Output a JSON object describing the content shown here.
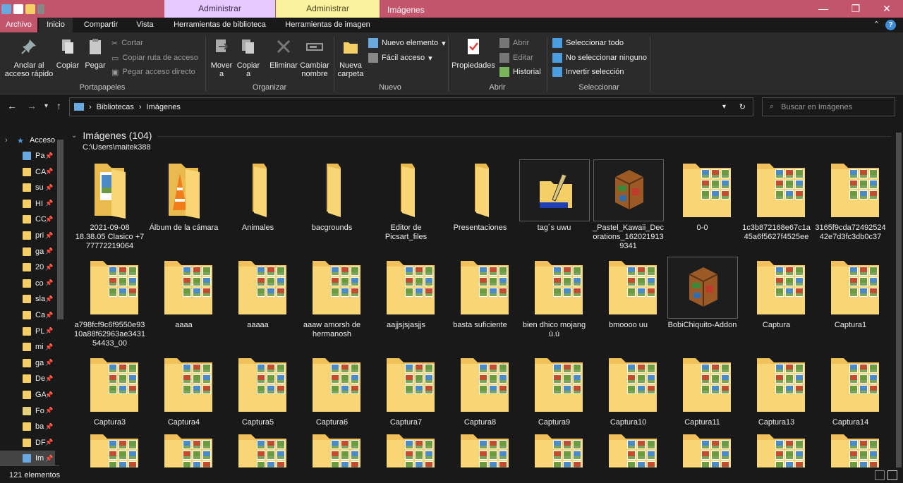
{
  "window": {
    "context_tab_1": "Administrar",
    "context_tab_2": "Administrar",
    "title": "Imágenes",
    "minimize": "—",
    "maximize": "❐",
    "close": "✕"
  },
  "tabs": {
    "file": "Archivo",
    "home": "Inicio",
    "share": "Compartir",
    "view": "Vista",
    "library_tools": "Herramientas de biblioteca",
    "picture_tools": "Herramientas de imagen",
    "help": "?"
  },
  "ribbon": {
    "pin_label": "Anclar al acceso rápido",
    "copy": "Copiar",
    "paste": "Pegar",
    "cut": "Cortar",
    "copy_path": "Copiar ruta de acceso",
    "paste_shortcut": "Pegar acceso directo",
    "group_clipboard": "Portapapeles",
    "move_to": "Mover a",
    "copy_to": "Copiar a",
    "delete": "Eliminar",
    "rename": "Cambiar nombre",
    "group_organize": "Organizar",
    "new_folder": "Nueva carpeta",
    "new_item": "Nuevo elemento",
    "easy_access": "Fácil acceso",
    "group_new": "Nuevo",
    "properties": "Propiedades",
    "open": "Abrir",
    "edit": "Editar",
    "history": "Historial",
    "group_open": "Abrir",
    "select_all": "Seleccionar todo",
    "select_none": "No seleccionar ninguno",
    "invert_selection": "Invertir selección",
    "group_select": "Seleccionar"
  },
  "address": {
    "crumb_1": "Bibliotecas",
    "crumb_2": "Imágenes",
    "search_placeholder": "Buscar en Imágenes"
  },
  "sidebar": {
    "quick_access": "Acceso",
    "items": [
      "Pa",
      "CA",
      "su",
      "HI",
      "CC",
      "pri",
      "ga",
      "20",
      "co",
      "sla",
      "Ca",
      "PL",
      "mi",
      "ga",
      "De",
      "GA",
      "Fo",
      "ba",
      "DF",
      "Im"
    ]
  },
  "content": {
    "group_title": "Imágenes (104)",
    "group_path": "C:\\Users\\maitek388",
    "items": [
      "2021-09-08 18.38.05 Clasico +7 77772219064",
      "Álbum de la cámara",
      "Animales",
      "bacgrounds",
      "Editor de Picsart_files",
      "Presentaciones",
      "tag´s uwu",
      "_Pastel_Kawaii_Decorations_1620219139341",
      "0-0",
      "1c3b872168e67c1a45a6f5627f4525ee",
      "3165f9cda7249252442e7d3fc3db0c37",
      "a798fcf9c6f9550e9310a88f62963ae343154433_00",
      "aaaa",
      "aaaaa",
      "aaaw amorsh de hermanosh",
      "aajjsjsjasjjs",
      "basta suficiente",
      "bien dhico mojang ù.ú",
      "bmoooo uu",
      "BobiChiquito-Addon",
      "Captura",
      "Captura1",
      "Captura3",
      "Captura4",
      "Captura5",
      "Captura6",
      "Captura7",
      "Captura8",
      "Captura9",
      "Captura10",
      "Captura11",
      "Captura13",
      "Captura14"
    ]
  },
  "status": {
    "count": "121 elementos"
  },
  "colors": {
    "titlebar": "#c2546c",
    "manage_library": "#e6c9ff",
    "manage_picture": "#fbf3a0",
    "folder": "#f4cf68",
    "background": "#191919"
  }
}
